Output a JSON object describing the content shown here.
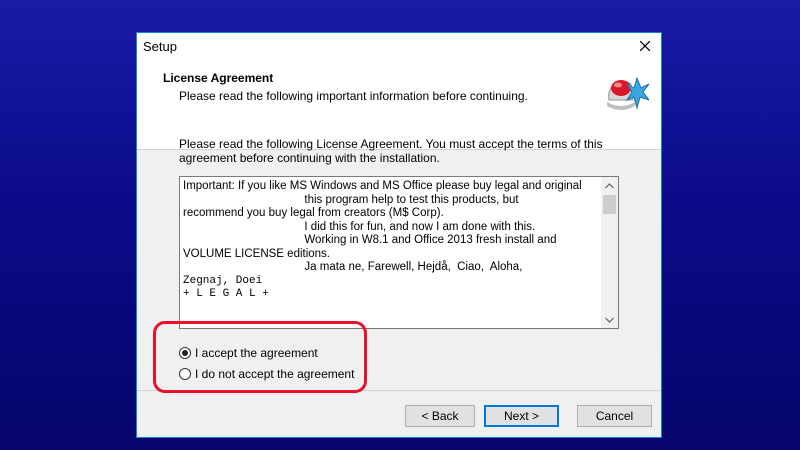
{
  "window": {
    "title": "Setup",
    "header": {
      "title": "License Agreement",
      "subtitle": "Please read the following important information before continuing."
    },
    "intro_text": "Please read the following License Agreement. You must accept the terms of this agreement before continuing with the installation.",
    "license_lines": [
      "Important: If you like MS Windows and MS Office please buy legal and original",
      "                                      this program help to test this products, but",
      "recommend you buy legal from creators (M$ Corp).",
      "                                      I did this for fun, and now I am done with this.",
      "                                      Working in W8.1 and Office 2013 fresh install and",
      "VOLUME LICENSE editions.",
      "                                      Ja mata ne, Farewell, Hejdå,  Ciao,  Aloha,",
      "Zegnaj, Doei",
      "",
      "+ L E G A L +"
    ],
    "radio_options": [
      {
        "label": "I accept the agreement",
        "checked": true
      },
      {
        "label": "I do not accept the agreement",
        "checked": false
      }
    ],
    "buttons": {
      "back": "< Back",
      "next": "Next >",
      "cancel": "Cancel"
    }
  },
  "colors": {
    "background": "#0b0b8a",
    "highlight": "#e8102a",
    "default_button_border": "#0078d7"
  },
  "icons": {
    "close": "close-icon",
    "app": "setup-app-icon",
    "scroll_up": "chevron-up-icon",
    "scroll_down": "chevron-down-icon"
  }
}
